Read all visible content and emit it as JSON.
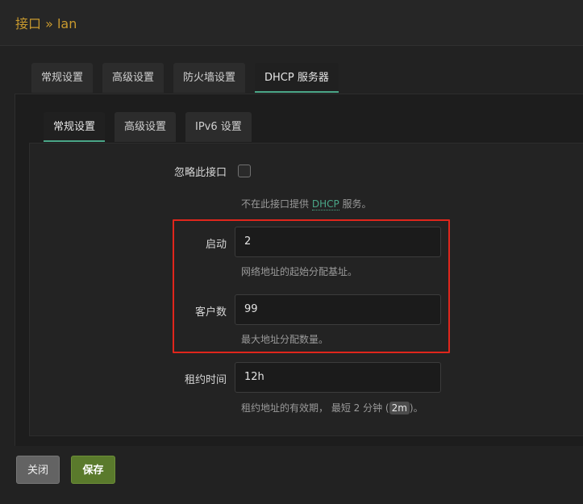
{
  "dialog": {
    "title": "接口 » lan"
  },
  "tabs": [
    {
      "label": "常规设置",
      "active": false
    },
    {
      "label": "高级设置",
      "active": false
    },
    {
      "label": "防火墙设置",
      "active": false
    },
    {
      "label": "DHCP 服务器",
      "active": true
    }
  ],
  "subtabs": [
    {
      "label": "常规设置",
      "active": true
    },
    {
      "label": "高级设置",
      "active": false
    },
    {
      "label": "IPv6 设置",
      "active": false
    }
  ],
  "form": {
    "ignore": {
      "label": "忽略此接口",
      "checked": false,
      "help_prefix": "不在此接口提供 ",
      "help_abbr": "DHCP",
      "help_suffix": " 服务。"
    },
    "start": {
      "label": "启动",
      "value": "2",
      "help": "网络地址的起始分配基址。"
    },
    "limit": {
      "label": "客户数",
      "value": "99",
      "help": "最大地址分配数量。"
    },
    "leasetime": {
      "label": "租约时间",
      "value": "12h",
      "help_prefix": "租约地址的有效期，  最短 2 分钟 (",
      "help_code": "2m",
      "help_suffix": ")。"
    }
  },
  "footer": {
    "close_label": "关闭",
    "save_label": "保存"
  },
  "colors": {
    "title": "#c99a2e",
    "accent": "#4aa687",
    "highlight_border": "#e0261c",
    "save_button": "#5a7a2c"
  }
}
